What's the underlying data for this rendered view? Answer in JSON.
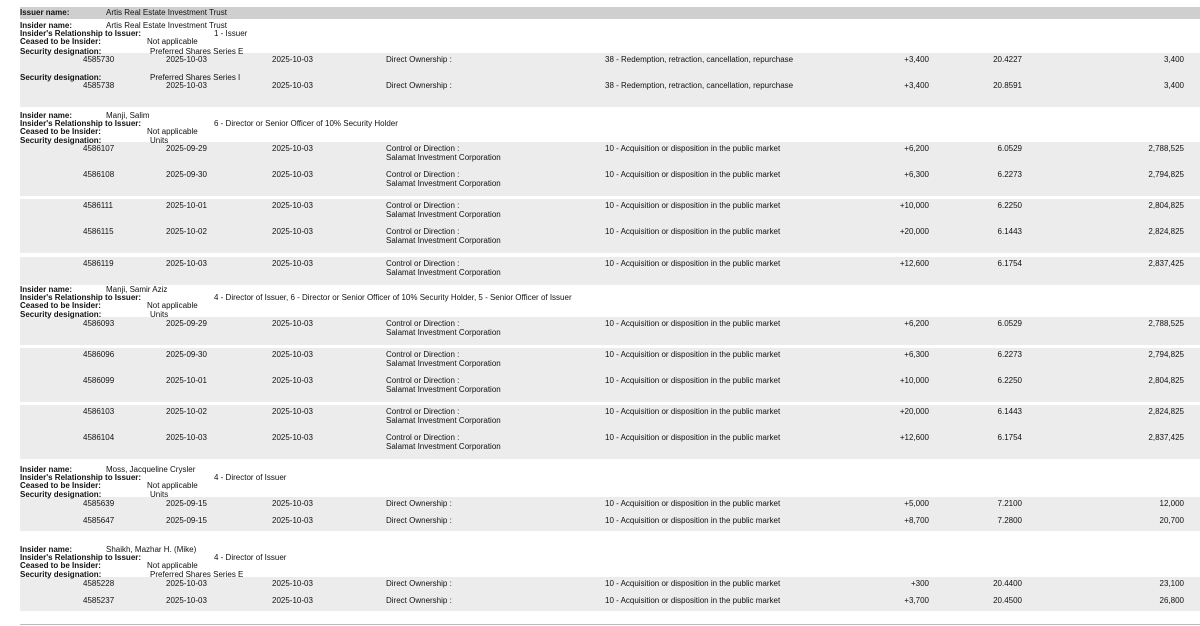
{
  "issuer": {
    "label": "Issuer name:",
    "value": "Artis Real Estate Investment Trust"
  },
  "labels": {
    "insider_name": "Insider name:",
    "relationship": "Insider's Relationship to Issuer:",
    "ceased": "Ceased to be Insider:",
    "security": "Security designation:"
  },
  "insiders": [
    {
      "name": "Artis Real Estate Investment Trust",
      "relationship": "1 - Issuer",
      "ceased": "Not applicable",
      "securities": [
        {
          "designation": "Preferred Shares Series E",
          "transactions": [
            {
              "id": "4585730",
              "date": "2025-10-03",
              "filed": "2025-10-03",
              "ownership": "Direct Ownership :",
              "holder": "",
              "nature": "38 - Redemption, retraction, cancellation, repurchase",
              "change": "+3,400",
              "price": "20.4227",
              "holdings": "3,400"
            }
          ]
        },
        {
          "designation": "Preferred Shares Series I",
          "transactions": [
            {
              "id": "4585738",
              "date": "2025-10-03",
              "filed": "2025-10-03",
              "ownership": "Direct Ownership :",
              "holder": "",
              "nature": "38 - Redemption, retraction, cancellation, repurchase",
              "change": "+3,400",
              "price": "20.8591",
              "holdings": "3,400"
            }
          ]
        }
      ]
    },
    {
      "name": "Manji, Salim",
      "relationship": "6 - Director or Senior Officer of 10% Security Holder",
      "ceased": "Not applicable",
      "securities": [
        {
          "designation": "Units",
          "transactions": [
            {
              "id": "4586107",
              "date": "2025-09-29",
              "filed": "2025-10-03",
              "ownership": "Control or Direction :",
              "holder": "Salamat Investment Corporation",
              "nature": "10 - Acquisition or disposition in the public market",
              "change": "+6,200",
              "price": "6.0529",
              "holdings": "2,788,525"
            },
            {
              "id": "4586108",
              "date": "2025-09-30",
              "filed": "2025-10-03",
              "ownership": "Control or Direction :",
              "holder": "Salamat Investment Corporation",
              "nature": "10 - Acquisition or disposition in the public market",
              "change": "+6,300",
              "price": "6.2273",
              "holdings": "2,794,825"
            },
            {
              "id": "4586111",
              "date": "2025-10-01",
              "filed": "2025-10-03",
              "ownership": "Control or Direction :",
              "holder": "Salamat Investment Corporation",
              "nature": "10 - Acquisition or disposition in the public market",
              "change": "+10,000",
              "price": "6.2250",
              "holdings": "2,804,825"
            },
            {
              "id": "4586115",
              "date": "2025-10-02",
              "filed": "2025-10-03",
              "ownership": "Control or Direction :",
              "holder": "Salamat Investment Corporation",
              "nature": "10 - Acquisition or disposition in the public market",
              "change": "+20,000",
              "price": "6.1443",
              "holdings": "2,824,825"
            },
            {
              "id": "4586119",
              "date": "2025-10-03",
              "filed": "2025-10-03",
              "ownership": "Control or Direction :",
              "holder": "Salamat Investment Corporation",
              "nature": "10 - Acquisition or disposition in the public market",
              "change": "+12,600",
              "price": "6.1754",
              "holdings": "2,837,425"
            }
          ]
        }
      ]
    },
    {
      "name": "Manji, Samir Aziz",
      "relationship": "4 - Director of Issuer, 6 - Director or Senior Officer of 10% Security Holder, 5 - Senior Officer of Issuer",
      "ceased": "Not applicable",
      "securities": [
        {
          "designation": "Units",
          "transactions": [
            {
              "id": "4586093",
              "date": "2025-09-29",
              "filed": "2025-10-03",
              "ownership": "Control or Direction :",
              "holder": "Salamat Investment Corporation",
              "nature": "10 - Acquisition or disposition in the public market",
              "change": "+6,200",
              "price": "6.0529",
              "holdings": "2,788,525"
            },
            {
              "id": "4586096",
              "date": "2025-09-30",
              "filed": "2025-10-03",
              "ownership": "Control or Direction :",
              "holder": "Salamat Investment Corporation",
              "nature": "10 - Acquisition or disposition in the public market",
              "change": "+6,300",
              "price": "6.2273",
              "holdings": "2,794,825"
            },
            {
              "id": "4586099",
              "date": "2025-10-01",
              "filed": "2025-10-03",
              "ownership": "Control or Direction :",
              "holder": "Salamat Investment Corporation",
              "nature": "10 - Acquisition or disposition in the public market",
              "change": "+10,000",
              "price": "6.2250",
              "holdings": "2,804,825"
            },
            {
              "id": "4586103",
              "date": "2025-10-02",
              "filed": "2025-10-03",
              "ownership": "Control or Direction :",
              "holder": "Salamat Investment Corporation",
              "nature": "10 - Acquisition or disposition in the public market",
              "change": "+20,000",
              "price": "6.1443",
              "holdings": "2,824,825"
            },
            {
              "id": "4586104",
              "date": "2025-10-03",
              "filed": "2025-10-03",
              "ownership": "Control or Direction :",
              "holder": "Salamat Investment Corporation",
              "nature": "10 - Acquisition or disposition in the public market",
              "change": "+12,600",
              "price": "6.1754",
              "holdings": "2,837,425"
            }
          ]
        }
      ]
    },
    {
      "name": "Moss, Jacqueline Crysler",
      "relationship": "4 - Director of Issuer",
      "ceased": "Not applicable",
      "securities": [
        {
          "designation": "Units",
          "transactions": [
            {
              "id": "4585639",
              "date": "2025-09-15",
              "filed": "2025-10-03",
              "ownership": "Direct Ownership :",
              "holder": "",
              "nature": "10 - Acquisition or disposition in the public market",
              "change": "+5,000",
              "price": "7.2100",
              "holdings": "12,000"
            },
            {
              "id": "4585647",
              "date": "2025-09-15",
              "filed": "2025-10-03",
              "ownership": "Direct Ownership :",
              "holder": "",
              "nature": "10 - Acquisition or disposition in the public market",
              "change": "+8,700",
              "price": "7.2800",
              "holdings": "20,700"
            }
          ]
        }
      ]
    },
    {
      "name": "Shaikh, Mazhar H. (Mike)",
      "relationship": "4 - Director of Issuer",
      "ceased": "Not applicable",
      "securities": [
        {
          "designation": "Preferred Shares Series E",
          "transactions": [
            {
              "id": "4585228",
              "date": "2025-10-03",
              "filed": "2025-10-03",
              "ownership": "Direct Ownership :",
              "holder": "",
              "nature": "10 - Acquisition or disposition in the public market",
              "change": "+300",
              "price": "20.4400",
              "holdings": "23,100"
            },
            {
              "id": "4585237",
              "date": "2025-10-03",
              "filed": "2025-10-03",
              "ownership": "Direct Ownership :",
              "holder": "",
              "nature": "10 - Acquisition or disposition in the public market",
              "change": "+3,700",
              "price": "20.4500",
              "holdings": "26,800"
            }
          ]
        }
      ]
    }
  ]
}
